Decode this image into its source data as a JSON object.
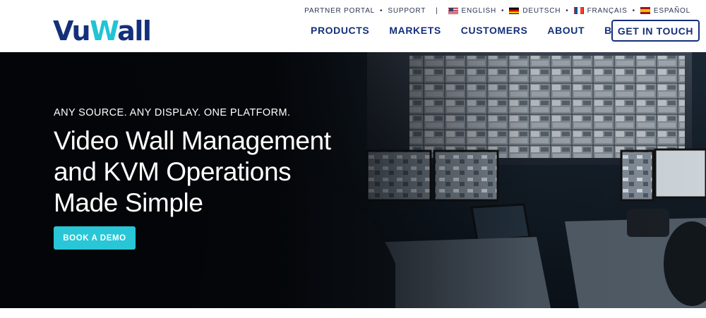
{
  "brand": {
    "logo_vu": "Vu",
    "logo_w": "W",
    "logo_all": "all",
    "colors": {
      "navy": "#14307a",
      "accent": "#20c4d4",
      "button": "#28c6d6"
    }
  },
  "utility": {
    "partner_portal": "PARTNER PORTAL",
    "dot": "•",
    "support": "SUPPORT",
    "pipe": "|",
    "languages": [
      {
        "flag": "us-flag-icon",
        "label": "ENGLISH"
      },
      {
        "flag": "de-flag-icon",
        "label": "DEUTSCH"
      },
      {
        "flag": "fr-flag-icon",
        "label": "FRANÇAIS"
      },
      {
        "flag": "es-flag-icon",
        "label": "ESPAÑOL"
      }
    ]
  },
  "nav": {
    "items": [
      "PRODUCTS",
      "MARKETS",
      "CUSTOMERS",
      "ABOUT",
      "BLOG"
    ],
    "cta": "GET IN TOUCH"
  },
  "hero": {
    "eyebrow": "ANY SOURCE. ANY DISPLAY. ONE PLATFORM.",
    "headline_lines": [
      "Video Wall Management",
      "and KVM Operations",
      "Made Simple"
    ],
    "button": "BOOK A DEMO",
    "background": "control-room-photo"
  }
}
